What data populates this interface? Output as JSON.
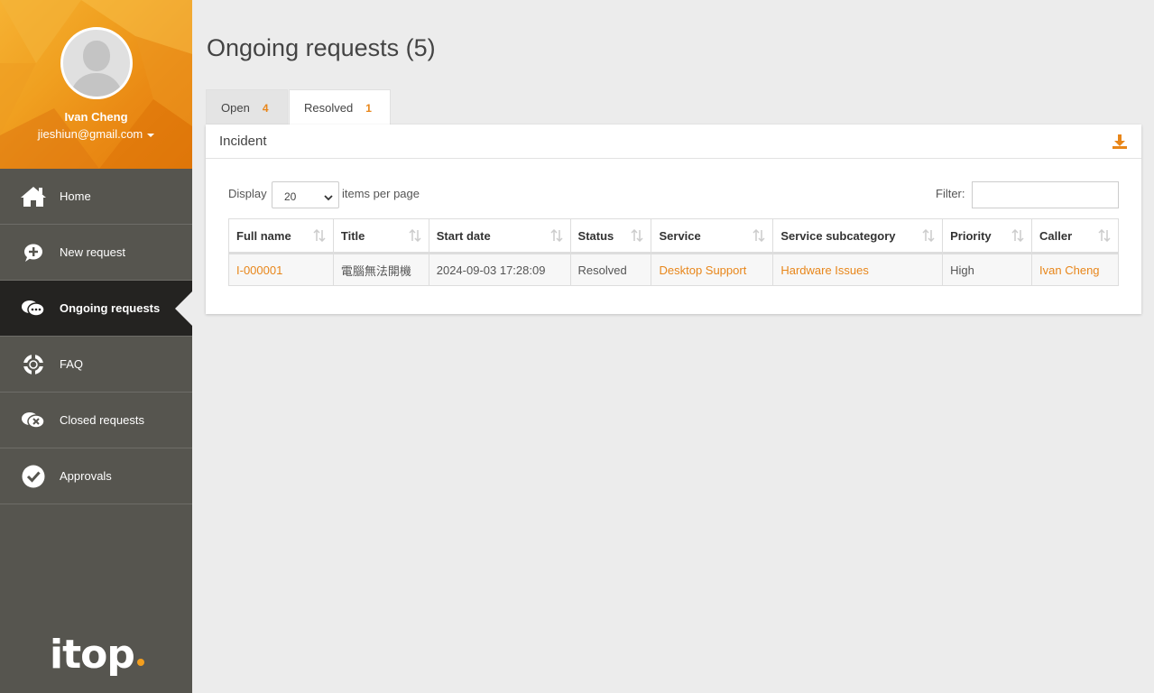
{
  "user": {
    "name": "Ivan Cheng",
    "email": "jieshiun@gmail.com"
  },
  "menu": [
    {
      "label": "Home",
      "icon": "home-icon"
    },
    {
      "label": "New request",
      "icon": "new-request-icon"
    },
    {
      "label": "Ongoing requests",
      "icon": "ongoing-requests-icon",
      "active": true
    },
    {
      "label": "FAQ",
      "icon": "lifebuoy-icon"
    },
    {
      "label": "Closed requests",
      "icon": "closed-requests-icon"
    },
    {
      "label": "Approvals",
      "icon": "check-circle-icon"
    }
  ],
  "logo": "itop",
  "page": {
    "title": "Ongoing requests (5)"
  },
  "tabs": [
    {
      "label": "Open",
      "count": "4"
    },
    {
      "label": "Resolved",
      "count": "1",
      "active": true
    }
  ],
  "panel": {
    "title": "Incident",
    "display_label": "Display",
    "page_size": "20",
    "per_page_label": "items per page",
    "filter_label": "Filter:",
    "filter_value": ""
  },
  "table": {
    "columns": [
      "Full name",
      "Title",
      "Start date",
      "Status",
      "Service",
      "Service subcategory",
      "Priority",
      "Caller"
    ],
    "rows": [
      [
        "I-000001",
        "電腦無法開機",
        "2024-09-03 17:28:09",
        "Resolved",
        "Desktop Support",
        "Hardware Issues",
        "High",
        "Ivan Cheng"
      ]
    ]
  },
  "colors": {
    "accent": "#e8861a",
    "sidebar": "#56554f",
    "active_item": "#242321",
    "background": "#ececec"
  }
}
